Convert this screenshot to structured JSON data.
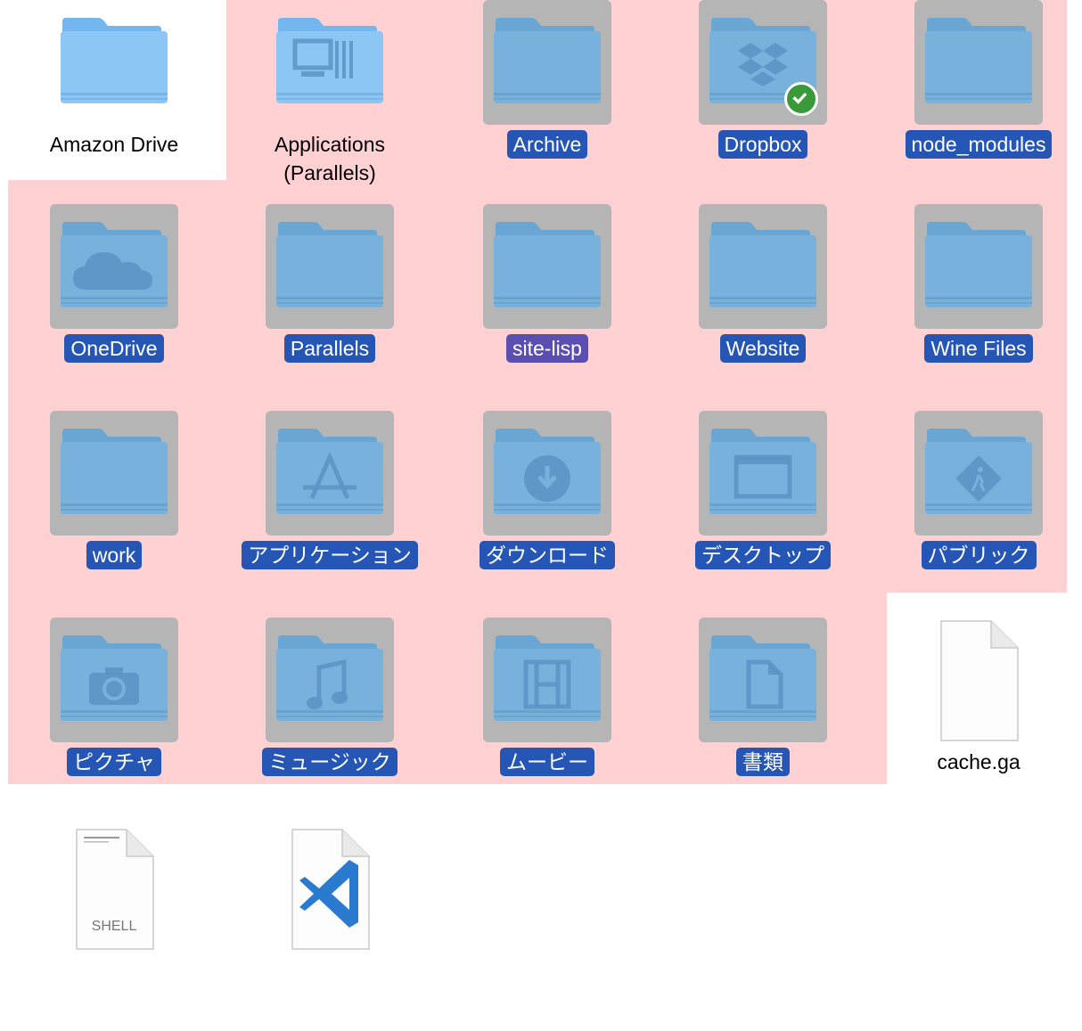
{
  "selection_color": "#2555b5",
  "selection_region_color": "#ffd1d3",
  "folder_color": "#7fb8e6",
  "items": [
    {
      "name": "Amazon Drive",
      "kind": "folder",
      "icon": "plain-folder-icon",
      "selected": false
    },
    {
      "name": "Applications\n(Parallels)",
      "kind": "folder",
      "icon": "parallels-apps-folder-icon",
      "selected": false
    },
    {
      "name": "Archive",
      "kind": "folder",
      "icon": "plain-folder-icon",
      "selected": true
    },
    {
      "name": "Dropbox",
      "kind": "folder",
      "icon": "dropbox-folder-icon",
      "badge": "synced-check-icon",
      "selected": true
    },
    {
      "name": "node_modules",
      "kind": "folder",
      "icon": "plain-folder-icon",
      "selected": true
    },
    {
      "name": "OneDrive",
      "kind": "folder",
      "icon": "onedrive-folder-icon",
      "selected": true
    },
    {
      "name": "Parallels",
      "kind": "folder",
      "icon": "plain-folder-icon",
      "selected": true
    },
    {
      "name": "site-lisp",
      "kind": "folder",
      "icon": "plain-folder-icon",
      "selected": true
    },
    {
      "name": "Website",
      "kind": "folder",
      "icon": "plain-folder-icon",
      "selected": true
    },
    {
      "name": "Wine Files",
      "kind": "folder",
      "icon": "plain-folder-icon",
      "selected": true
    },
    {
      "name": "work",
      "kind": "folder",
      "icon": "plain-folder-icon",
      "selected": true
    },
    {
      "name": "アプリケーション",
      "kind": "folder",
      "icon": "applications-folder-icon",
      "selected": true
    },
    {
      "name": "ダウンロード",
      "kind": "folder",
      "icon": "downloads-folder-icon",
      "selected": true
    },
    {
      "name": "デスクトップ",
      "kind": "folder",
      "icon": "desktop-folder-icon",
      "selected": true
    },
    {
      "name": "パブリック",
      "kind": "folder",
      "icon": "public-folder-icon",
      "selected": true
    },
    {
      "name": "ピクチャ",
      "kind": "folder",
      "icon": "pictures-folder-icon",
      "selected": true
    },
    {
      "name": "ミュージック",
      "kind": "folder",
      "icon": "music-folder-icon",
      "selected": true
    },
    {
      "name": "ムービー",
      "kind": "folder",
      "icon": "movies-folder-icon",
      "selected": true
    },
    {
      "name": "書類",
      "kind": "folder",
      "icon": "documents-folder-icon",
      "selected": true
    },
    {
      "name": "cache.ga",
      "kind": "file",
      "icon": "blank-document-icon",
      "selected": false
    },
    {
      "name": "",
      "kind": "file",
      "icon": "shell-script-document-icon",
      "caption": "SHELL",
      "selected": false
    },
    {
      "name": "",
      "kind": "file",
      "icon": "vscode-document-icon",
      "selected": false
    }
  ]
}
